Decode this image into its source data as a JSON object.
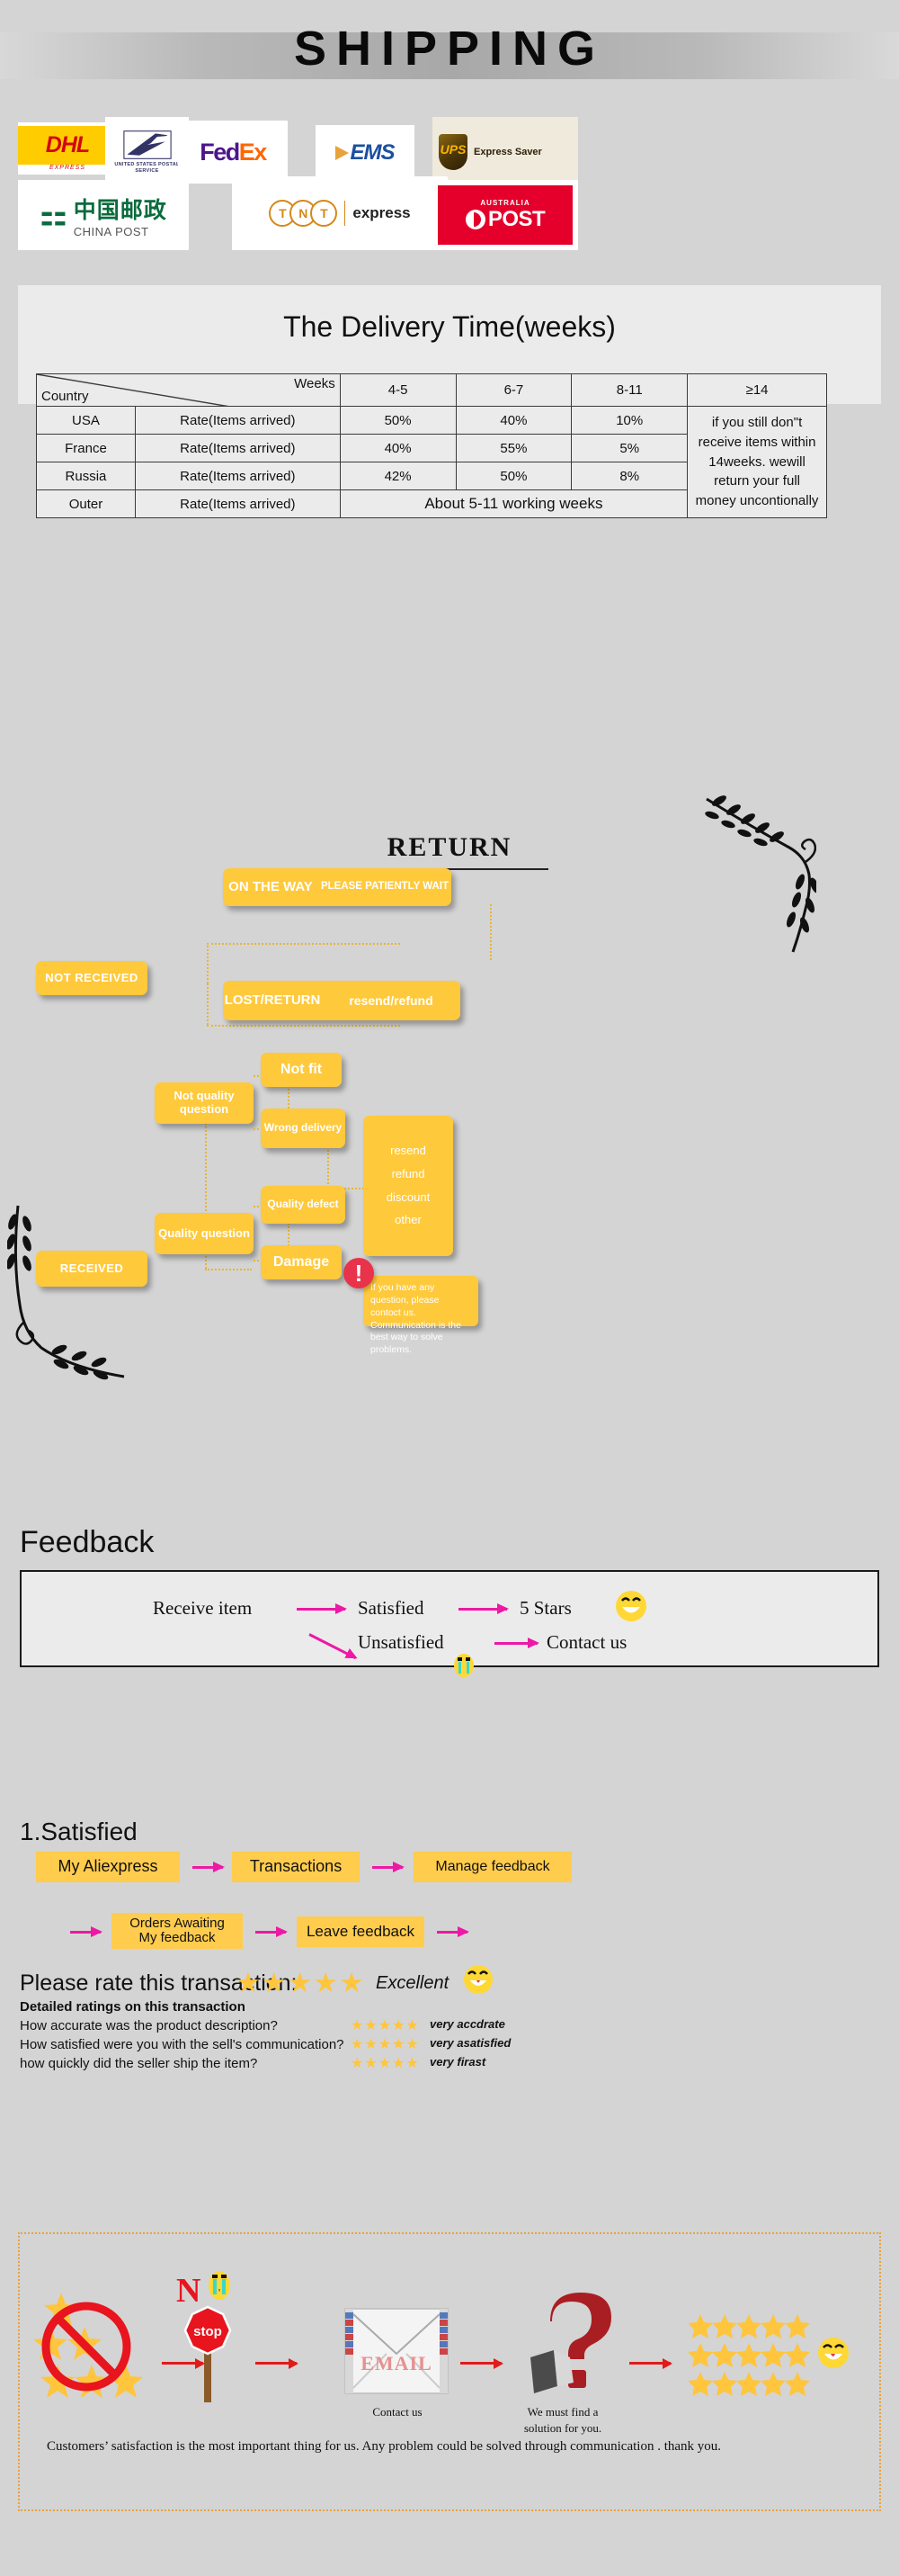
{
  "header": {
    "title": "SHIPPING"
  },
  "carriers": [
    {
      "name": "dhl",
      "label": "DHL",
      "sub": "EXPRESS"
    },
    {
      "name": "usps",
      "label": "UNITED STATES POSTAL SERVICE"
    },
    {
      "name": "fedex",
      "label_1": "Fed",
      "label_2": "Ex"
    },
    {
      "name": "ems",
      "label": "EMS"
    },
    {
      "name": "ups",
      "label": "UPS",
      "sub": "Express Saver"
    },
    {
      "name": "china-post",
      "label_cn": "中国邮政",
      "label_en": "CHINA POST"
    },
    {
      "name": "tnt",
      "label": "TNT",
      "sub": "express"
    },
    {
      "name": "australia-post",
      "label": "POST",
      "sub": "AUSTRALIA"
    }
  ],
  "delivery": {
    "title": "The Delivery Time(weeks)",
    "corner_top": "Weeks",
    "corner_bottom": "Country",
    "week_columns": [
      "4-5",
      "6-7",
      "8-11",
      "≥14"
    ],
    "rate_label": "Rate(Items arrived)",
    "rows": [
      {
        "country": "USA",
        "rate": "Rate(Items arrived)",
        "values": [
          "50%",
          "40%",
          "10%"
        ]
      },
      {
        "country": "France",
        "rate": "Rate(Items arrived)",
        "values": [
          "40%",
          "55%",
          "5%"
        ]
      },
      {
        "country": "Russia",
        "rate": "Rate(Items arrived)",
        "values": [
          "42%",
          "50%",
          "8%"
        ]
      }
    ],
    "outer": {
      "country": "Outer",
      "rate": "Rate(Items arrived)",
      "text": "About 5-11 working weeks"
    },
    "note": "if you still don\"t receive items within 14weeks. wewill return your full money uncontionally"
  },
  "return": {
    "title": "RETURN",
    "not_received": "NOT RECEIVED",
    "received": "RECEIVED",
    "on_the_way": "ON THE WAY",
    "on_the_way_action": "PLEASE PATIENTLY WAIT",
    "lost_return": "LOST/RETURN",
    "lost_return_action": "resend/refund",
    "not_quality_question": "Not quality question",
    "quality_question": "Quality question",
    "not_fit": "Not fit",
    "wrong_delivery": "Wrong delivery",
    "quality_defect": "Quality defect",
    "damage": "Damage",
    "outcomes": [
      "resend",
      "refund",
      "discount",
      "other"
    ],
    "alert_mark": "!",
    "note": "If you have any question, please contoct us. Communication is the best way to solve problems."
  },
  "feedback": {
    "title": "Feedback",
    "receive_item": "Receive item",
    "satisfied": "Satisfied",
    "five_stars": "5 Stars",
    "unsatisfied": "Unsatisfied",
    "contact_us": "Contact us"
  },
  "satisfied_steps": {
    "title": "1.Satisfied",
    "row1": [
      "My Aliexpress",
      "Transactions",
      "Manage feedback"
    ],
    "row2": [
      "Orders Awaiting\nMy feedback",
      "Leave feedback"
    ]
  },
  "rating": {
    "prompt": "Please rate this transaction:",
    "prompt_stars": "★★★★★",
    "prompt_label": "Excellent",
    "subtitle": "Detailed ratings on this transaction",
    "rows": [
      {
        "question": "How accurate was the product description?",
        "stars": "★★★★★",
        "label": "very accdrate"
      },
      {
        "question": "How satisfied were you with the sell's communication?",
        "stars": "★★★★★",
        "label": "very asatisfied"
      },
      {
        "question": "how quickly did the seller ship the item?",
        "stars": "★★★★★",
        "label": "very firast"
      }
    ]
  },
  "bottom": {
    "no_sign": "no-rating-sign",
    "n_letter": "N",
    "stop_label": "stop",
    "email_label": "EMAIL",
    "question_mark": "?",
    "caption_email": "Contact us",
    "caption_question": "We must find a solution for you.",
    "note": "Customers’ satisfaction is the most important thing for us. Any problem could be solved through communication . thank you."
  },
  "colors": {
    "background": "#d4d4d4",
    "panel": "#ebebeb",
    "amber": "#FFC93C",
    "green": "#A5DC4E",
    "yellow_box": "#FFCC4D",
    "magenta": "#ED18A5",
    "red": "#E01B1B",
    "alert_red": "#E8334A",
    "star": "#FFC53D",
    "dotted": "#E8A33D"
  }
}
